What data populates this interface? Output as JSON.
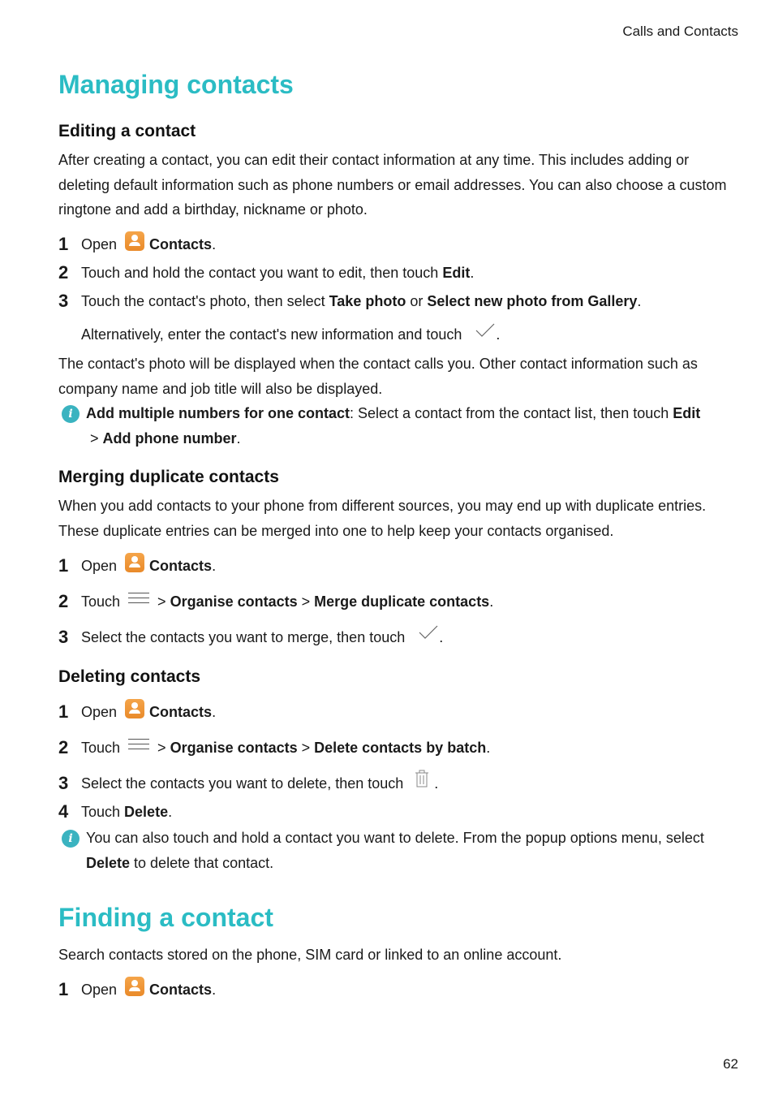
{
  "header": {
    "section": "Calls and Contacts"
  },
  "footer": {
    "page_number": "62"
  },
  "managing": {
    "title": "Managing contacts",
    "editing": {
      "heading": "Editing a contact",
      "intro": "After creating a contact, you can edit their contact information at any time. This includes adding or deleting default information such as phone numbers or email addresses. You can also choose a custom ringtone and add a birthday, nickname or photo.",
      "steps": [
        {
          "num": "1",
          "pre": "Open",
          "bold": "Contacts",
          "post": "."
        },
        {
          "num": "2",
          "pre": "Touch and hold the contact you want to edit, then touch ",
          "bold": "Edit",
          "post": "."
        },
        {
          "num": "3",
          "pre": "Touch the contact's photo, then select ",
          "bold": "Take photo",
          "mid": " or ",
          "bold2": "Select new photo from Gallery",
          "post": "."
        }
      ],
      "alt_text": "Alternatively, enter the contact's new information and touch",
      "alt_post": ".",
      "after": "The contact's photo will be displayed when the contact calls you. Other contact information such as company name and job title will also be displayed.",
      "note": {
        "bold": "Add multiple numbers for one contact",
        "text": ": Select a contact from the contact list, then touch ",
        "bold2": "Edit",
        "sep": " > ",
        "bold3": "Add phone number",
        "post": "."
      }
    },
    "merging": {
      "heading": "Merging duplicate contacts",
      "intro": "When you add contacts to your phone from different sources, you may end up with duplicate entries. These duplicate entries can be merged into one to help keep your contacts organised.",
      "steps": [
        {
          "num": "1",
          "pre": "Open",
          "bold": "Contacts",
          "post": "."
        },
        {
          "num": "2",
          "pre": "Touch",
          "sep1": "> ",
          "bold": "Organise contacts",
          "sep2": " > ",
          "bold2": "Merge duplicate contacts",
          "post": "."
        },
        {
          "num": "3",
          "pre": "Select the contacts you want to merge, then touch",
          "post": "."
        }
      ]
    },
    "deleting": {
      "heading": "Deleting contacts",
      "steps": [
        {
          "num": "1",
          "pre": "Open",
          "bold": "Contacts",
          "post": "."
        },
        {
          "num": "2",
          "pre": "Touch",
          "sep1": "> ",
          "bold": "Organise contacts",
          "sep2": " > ",
          "bold2": "Delete contacts by batch",
          "post": "."
        },
        {
          "num": "3",
          "pre": "Select the contacts you want to delete, then touch",
          "post": "."
        },
        {
          "num": "4",
          "pre": "Touch ",
          "bold": "Delete",
          "post": "."
        }
      ],
      "note": {
        "text": "You can also touch and hold a contact you want to delete. From the popup options menu, select ",
        "bold": "Delete",
        "post": " to delete that contact."
      }
    }
  },
  "finding": {
    "title": "Finding a contact",
    "intro": "Search contacts stored on the phone, SIM card or linked to an online account.",
    "steps": [
      {
        "num": "1",
        "pre": "Open",
        "bold": "Contacts",
        "post": "."
      }
    ]
  },
  "icons": {
    "app": "contacts-app-icon",
    "menu": "menu-icon",
    "check": "checkmark-icon",
    "trash": "trash-icon",
    "info": "info-icon"
  },
  "colors": {
    "heading_accent": "#2bbcc4",
    "info_icon": "#3ab3c0",
    "contacts_icon": "#ee9234"
  }
}
